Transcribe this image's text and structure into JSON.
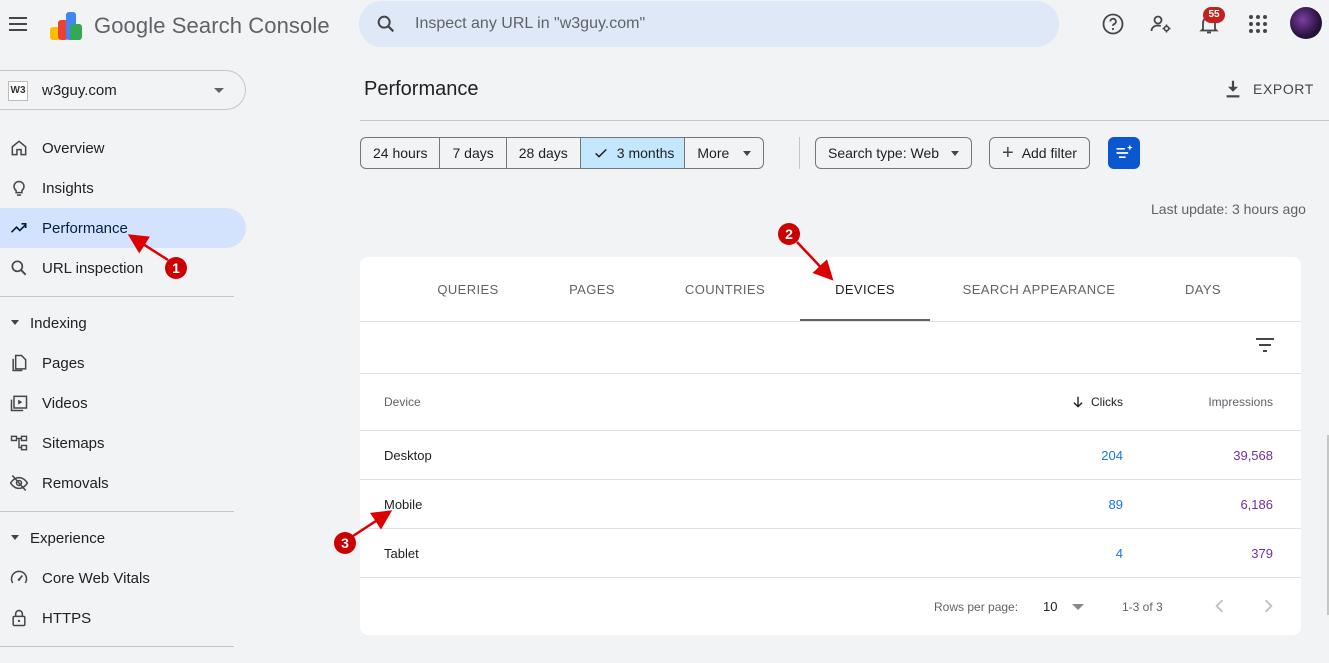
{
  "header": {
    "brand": "Google Search Console",
    "search_placeholder": "Inspect any URL in \"w3guy.com\"",
    "notification_count": "55",
    "icons": [
      "menu-icon",
      "search-icon",
      "help-icon",
      "manage-account-icon",
      "notifications-icon",
      "apps-icon"
    ]
  },
  "sidebar": {
    "property": {
      "icon_text": "W3",
      "name": "w3guy.com"
    },
    "items": [
      {
        "label": "Overview",
        "icon": "home-icon"
      },
      {
        "label": "Insights",
        "icon": "lightbulb-icon"
      },
      {
        "label": "Performance",
        "icon": "trending-up-icon",
        "active": true
      },
      {
        "label": "URL inspection",
        "icon": "search-icon"
      }
    ],
    "indexing": {
      "label": "Indexing",
      "items": [
        {
          "label": "Pages",
          "icon": "pages-icon"
        },
        {
          "label": "Videos",
          "icon": "video-icon"
        },
        {
          "label": "Sitemaps",
          "icon": "sitemap-icon"
        },
        {
          "label": "Removals",
          "icon": "eye-off-icon"
        }
      ]
    },
    "experience": {
      "label": "Experience",
      "items": [
        {
          "label": "Core Web Vitals",
          "icon": "speed-icon"
        },
        {
          "label": "HTTPS",
          "icon": "lock-icon"
        }
      ]
    }
  },
  "main": {
    "title": "Performance",
    "export_label": "EXPORT",
    "date_ranges": [
      "24 hours",
      "7 days",
      "28 days",
      "3 months",
      "More"
    ],
    "selected_range": "3 months",
    "search_type": "Search type: Web",
    "add_filter": "Add filter",
    "last_update": "Last update: 3 hours ago"
  },
  "card": {
    "tabs": [
      "QUERIES",
      "PAGES",
      "COUNTRIES",
      "DEVICES",
      "SEARCH APPEARANCE",
      "DAYS"
    ],
    "active_tab": "DEVICES",
    "columns": {
      "device": "Device",
      "clicks": "Clicks",
      "impressions": "Impressions"
    },
    "rows": [
      {
        "device": "Desktop",
        "clicks": "204",
        "impressions": "39,568"
      },
      {
        "device": "Mobile",
        "clicks": "89",
        "impressions": "6,186"
      },
      {
        "device": "Tablet",
        "clicks": "4",
        "impressions": "379"
      }
    ],
    "pager": {
      "rows_per_page_label": "Rows per page:",
      "rows_per_page": "10",
      "range": "1-3 of 3"
    }
  },
  "annotations": [
    "1",
    "2",
    "3"
  ],
  "colors": {
    "accent": "#0b57d0",
    "active_nav": "#d3e3fd",
    "clicks": "#1a73e8",
    "impressions": "#6e2fa3",
    "annotation": "#cc0000"
  }
}
